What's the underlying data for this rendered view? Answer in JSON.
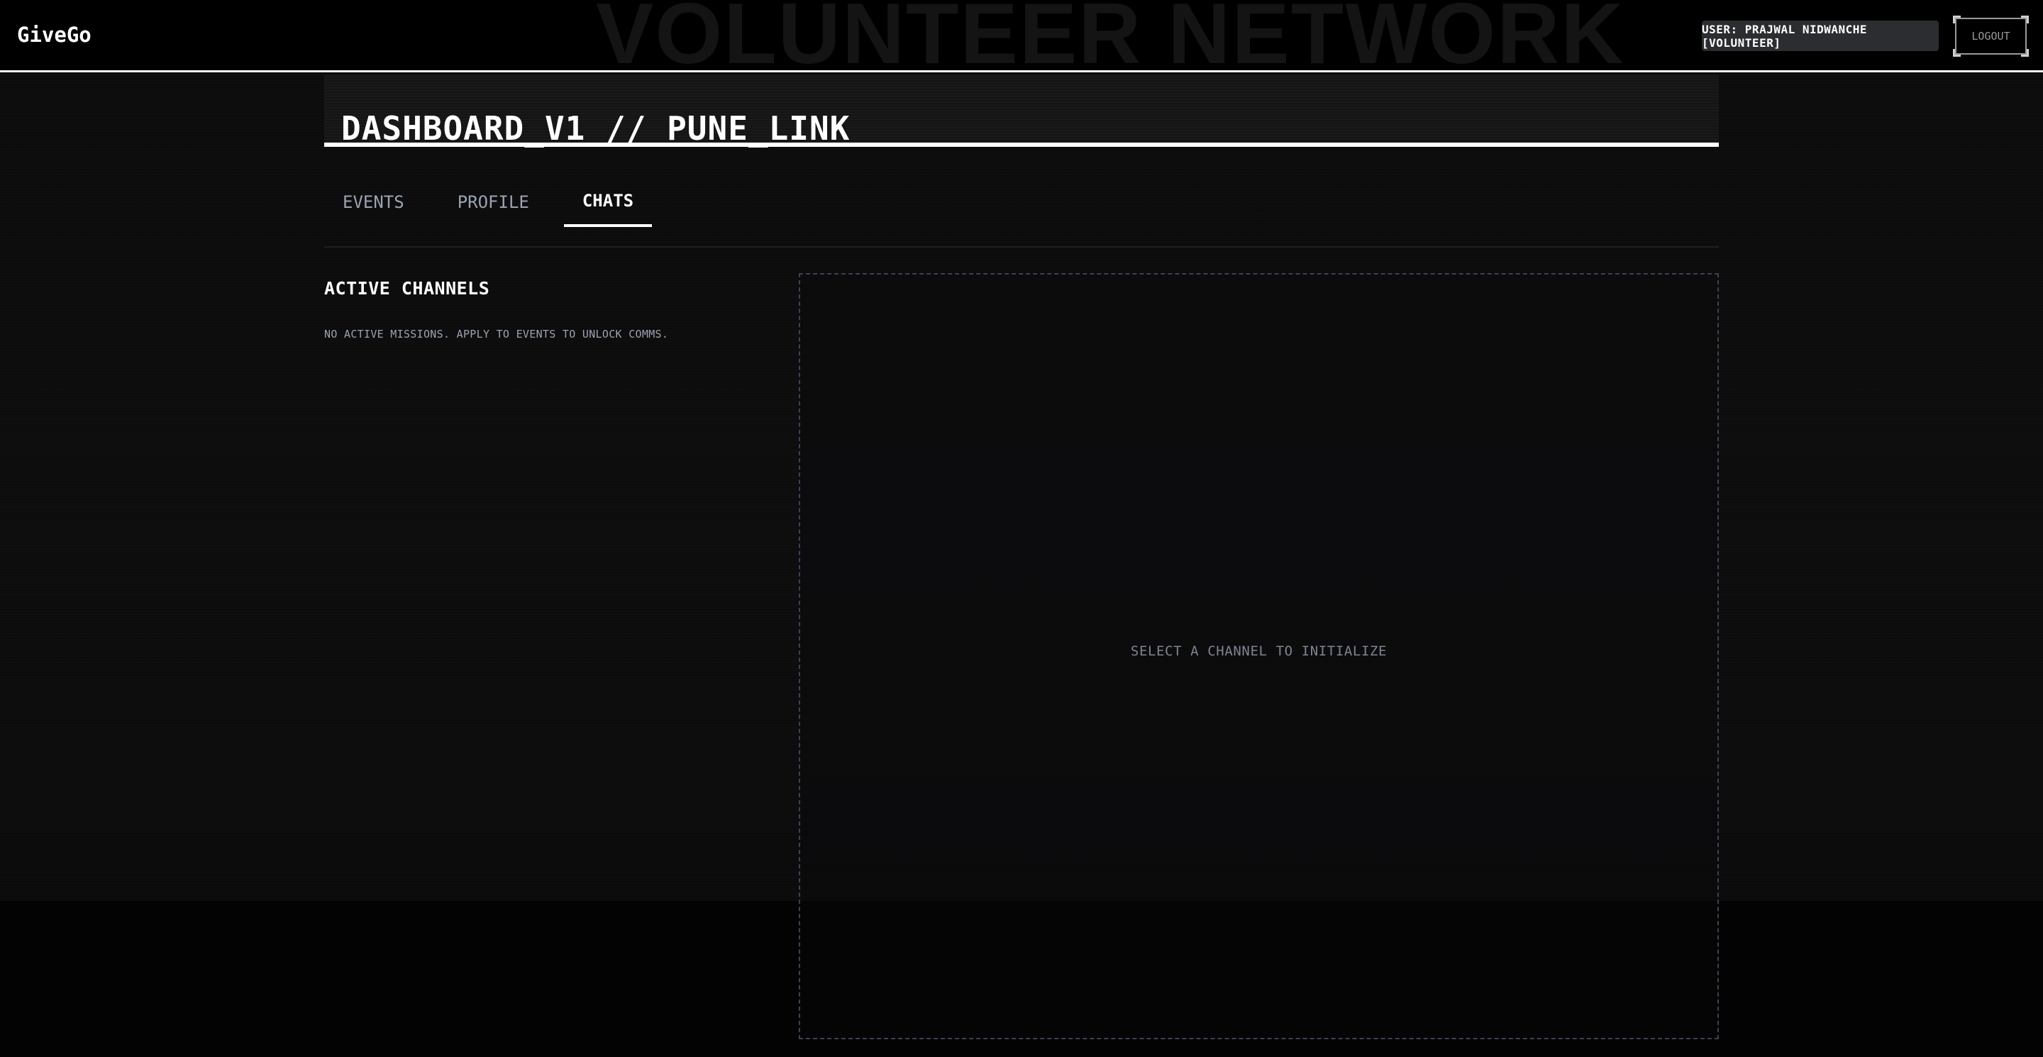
{
  "header": {
    "brand": "GiveGo",
    "watermark": "VOLUNTEER NETWORK",
    "user_badge": "USER: PRAJWAL NIDWANCHE [VOLUNTEER]",
    "logout_label": "LOGOUT"
  },
  "dashboard": {
    "title": "DASHBOARD_V1 // PUNE_LINK"
  },
  "tabs": [
    {
      "label": "EVENTS",
      "active": false
    },
    {
      "label": "PROFILE",
      "active": false
    },
    {
      "label": "CHATS",
      "active": true
    }
  ],
  "channels": {
    "title": "ACTIVE CHANNELS",
    "empty_message": "NO ACTIVE MISSIONS. APPLY TO EVENTS TO UNLOCK COMMS."
  },
  "chat_panel": {
    "placeholder": "SELECT A CHANNEL TO INITIALIZE"
  },
  "colors": {
    "background": "#050505",
    "accent": "#ffffff",
    "muted_text": "#9aa3b2",
    "badge_bg": "#2b2d30",
    "panel_border": "#3b4252"
  }
}
